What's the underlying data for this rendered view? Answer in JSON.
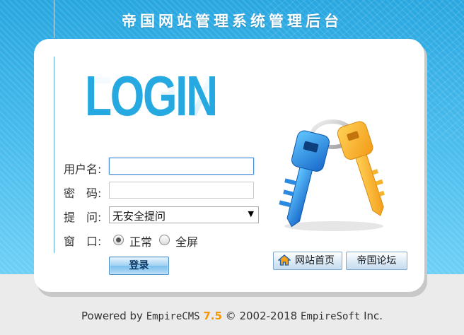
{
  "header": {
    "title": "帝国网站管理系统管理后台"
  },
  "logo": {
    "text": "LOGIN"
  },
  "form": {
    "username_label": "用户名:",
    "password_label": "密　码:",
    "question_label": "提　问:",
    "question_selected": "无安全提问",
    "window_label": "窗　口:",
    "window_options": [
      "正常",
      "全屏"
    ],
    "window_selected": "正常",
    "username_value": "",
    "password_value": "",
    "login_button": "登录"
  },
  "links": {
    "home": "网站首页",
    "forum": "帝国论坛"
  },
  "footer": {
    "powered_by": "Powered by",
    "product": "EmpireCMS",
    "version": "7.5",
    "copyright": "© 2002-2018",
    "company": "EmpireSoft",
    "suffix": "Inc."
  },
  "icons": [
    "home-icon",
    "keys-icon",
    "dropdown-arrow-icon"
  ],
  "colors": {
    "brand_blue": "#26a9e0",
    "version_orange": "#f39800"
  }
}
